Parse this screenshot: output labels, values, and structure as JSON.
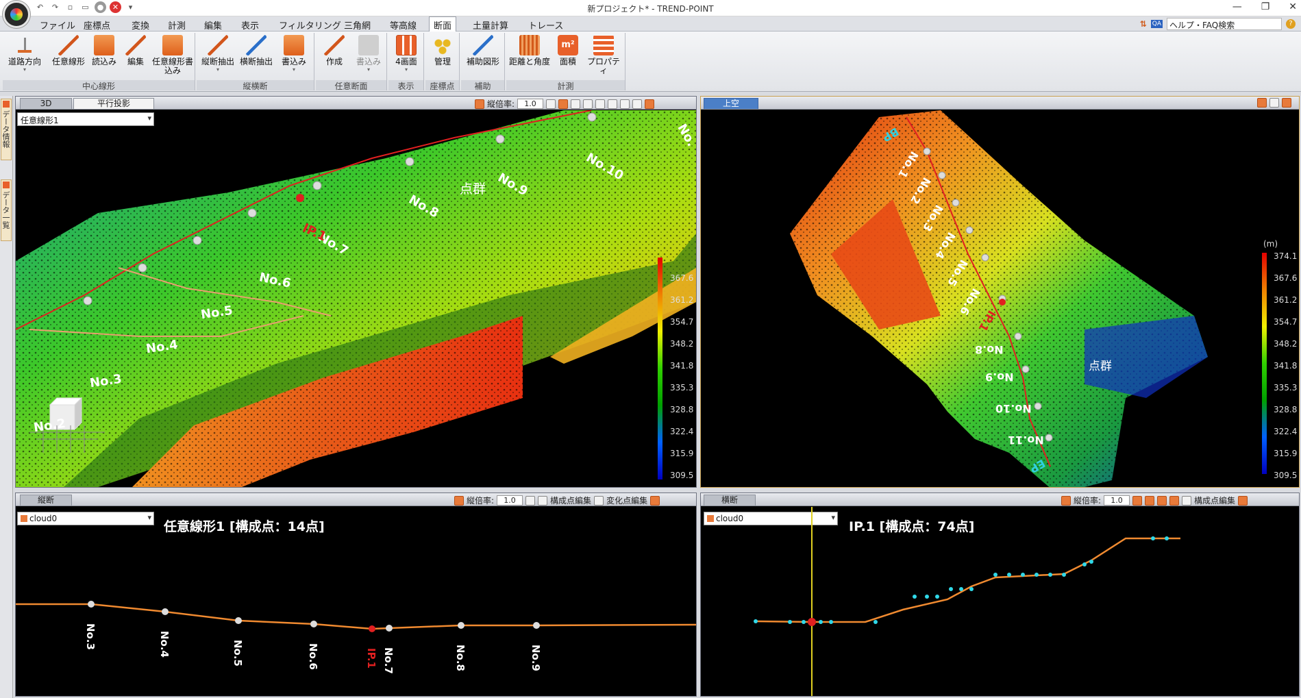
{
  "window": {
    "title": "新プロジェクト* - TREND-POINT",
    "controls": [
      "—",
      "❐",
      "✕"
    ]
  },
  "menu": [
    "ファイル",
    "座標点",
    "変換",
    "計測",
    "編集",
    "表示",
    "フィルタリング",
    "三角網",
    "等高線",
    "断面",
    "土量計算",
    "トレース"
  ],
  "menu_active": "断面",
  "help_search": "ヘルプ・FAQ検索",
  "ribbon": {
    "groups": [
      {
        "label": "中心線形",
        "buttons": [
          "道路方向",
          "任意線形",
          "読込み",
          "編集",
          "任意線形書込み"
        ]
      },
      {
        "label": "縦横断",
        "buttons": [
          "縦断抽出",
          "横断抽出",
          "書込み"
        ]
      },
      {
        "label": "任意断面",
        "buttons": [
          "作成",
          "書込み"
        ]
      },
      {
        "label": "表示",
        "buttons": [
          "4画面"
        ]
      },
      {
        "label": "座標点",
        "buttons": [
          "管理"
        ]
      },
      {
        "label": "補助",
        "buttons": [
          "補助図形"
        ]
      },
      {
        "label": "計測",
        "buttons": [
          "距離と角度",
          "面積",
          "プロパティ"
        ]
      }
    ]
  },
  "sidebar": {
    "tabs": [
      "データ情報",
      "データ一覧"
    ]
  },
  "pane_3d": {
    "tabs": [
      "3D",
      "平行投影"
    ],
    "scale_label": "縦倍率:",
    "scale_value": "1.0",
    "combo": "任意線形1",
    "point_group": "点群",
    "stations": [
      "No.2",
      "No.3",
      "No.4",
      "No.5",
      "No.6",
      "No.7",
      "No.8",
      "No.9",
      "No.10",
      "No."
    ],
    "ip": "IP.1",
    "colorbar_labels": [
      "367.6",
      "361.2",
      "354.7",
      "348.2",
      "341.8",
      "335.3",
      "328.8",
      "322.4",
      "315.9",
      "309.5"
    ]
  },
  "pane_top": {
    "tab": "上空",
    "unit": "(m)",
    "point_group": "点群",
    "stations": [
      "BP",
      "No.1",
      "No.2",
      "No.3",
      "No.4",
      "No.5",
      "No.6",
      "IP.1",
      "No.8",
      "No.9",
      "No.10",
      "No.11",
      "EP"
    ],
    "colorbar_labels": [
      "374.1",
      "367.6",
      "361.2",
      "354.7",
      "348.2",
      "341.8",
      "335.3",
      "328.8",
      "322.4",
      "315.9",
      "309.5"
    ]
  },
  "pane_long": {
    "tab": "縦断",
    "scale_label": "縦倍率:",
    "scale_value": "1.0",
    "tool1": "構成点編集",
    "tool2": "変化点編集",
    "combo": "cloud0",
    "title": "任意線形1 [構成点：14点]",
    "stations": [
      "No.3",
      "No.4",
      "No.5",
      "No.6",
      "IP.1",
      "No.7",
      "No.8",
      "No.9"
    ]
  },
  "pane_cross": {
    "tab": "横断",
    "scale_label": "縦倍率:",
    "scale_value": "1.0",
    "tool1": "構成点編集",
    "combo": "cloud0",
    "title": "IP.1 [構成点：74点]"
  }
}
